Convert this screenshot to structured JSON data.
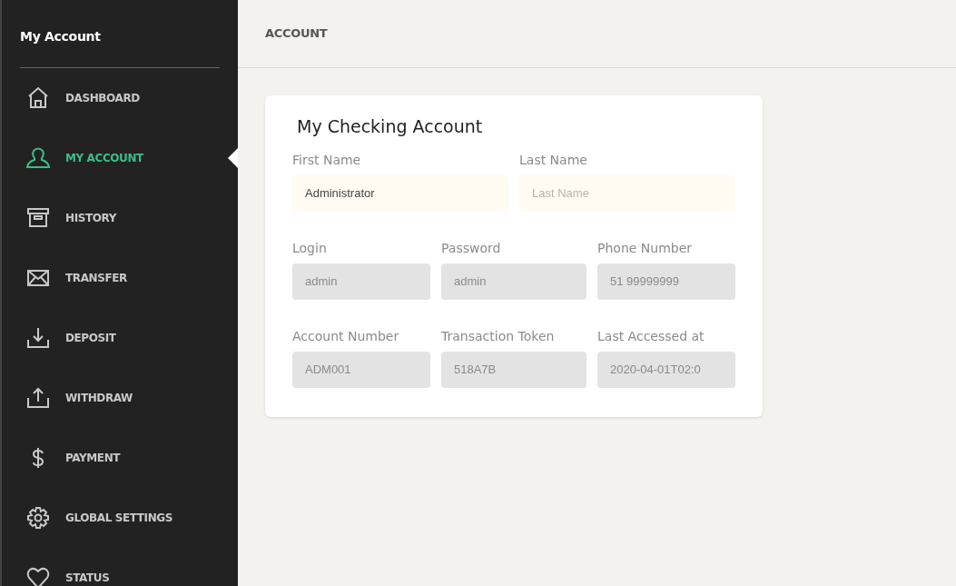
{
  "sidebar": {
    "title": "My Account",
    "items": [
      {
        "label": "DASHBOARD",
        "selected": false
      },
      {
        "label": "MY ACCOUNT",
        "selected": true
      },
      {
        "label": "HISTORY",
        "selected": false
      },
      {
        "label": "TRANSFER",
        "selected": false
      },
      {
        "label": "DEPOSIT",
        "selected": false
      },
      {
        "label": "WITHDRAW",
        "selected": false
      },
      {
        "label": "PAYMENT",
        "selected": false
      },
      {
        "label": "GLOBAL SETTINGS",
        "selected": false
      },
      {
        "label": "STATUS",
        "selected": false
      }
    ]
  },
  "header": {
    "title": "ACCOUNT"
  },
  "card": {
    "title": "My Checking Account",
    "rows": [
      [
        {
          "label": "First Name",
          "value": "Administrator",
          "disabled": false
        },
        {
          "label": "Last Name",
          "placeholder": "Last Name",
          "disabled": false
        }
      ],
      [
        {
          "label": "Login",
          "value": "admin",
          "disabled": true
        },
        {
          "label": "Password",
          "value": "admin",
          "disabled": true
        },
        {
          "label": "Phone Number",
          "value": "51 99999999",
          "disabled": true
        }
      ],
      [
        {
          "label": "Account Number",
          "value": "ADM001",
          "disabled": true
        },
        {
          "label": "Transaction Token",
          "value": "518A7B",
          "disabled": true
        },
        {
          "label": "Last Accessed at",
          "value": "2020-04-01T02:0",
          "disabled": true
        }
      ]
    ]
  }
}
